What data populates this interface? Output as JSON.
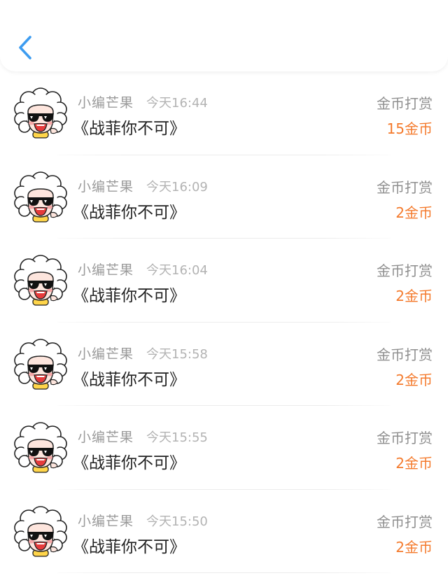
{
  "header": {
    "back_icon": "chevron-left-icon",
    "accent_color": "#3d9cf0"
  },
  "reward_list": [
    {
      "sender": "小编芒果",
      "time": "今天16:44",
      "book": "《战菲你不可》",
      "type": "金币打赏",
      "amount": "15金币"
    },
    {
      "sender": "小编芒果",
      "time": "今天16:09",
      "book": "《战菲你不可》",
      "type": "金币打赏",
      "amount": "2金币"
    },
    {
      "sender": "小编芒果",
      "time": "今天16:04",
      "book": "《战菲你不可》",
      "type": "金币打赏",
      "amount": "2金币"
    },
    {
      "sender": "小编芒果",
      "time": "今天15:58",
      "book": "《战菲你不可》",
      "type": "金币打赏",
      "amount": "2金币"
    },
    {
      "sender": "小编芒果",
      "time": "今天15:55",
      "book": "《战菲你不可》",
      "type": "金币打赏",
      "amount": "2金币"
    },
    {
      "sender": "小编芒果",
      "time": "今天15:50",
      "book": "《战菲你不可》",
      "type": "金币打赏",
      "amount": "2金币"
    }
  ],
  "colors": {
    "amount": "#f47a2c",
    "sender": "#9a9a9a",
    "time": "#b3b3b3"
  }
}
